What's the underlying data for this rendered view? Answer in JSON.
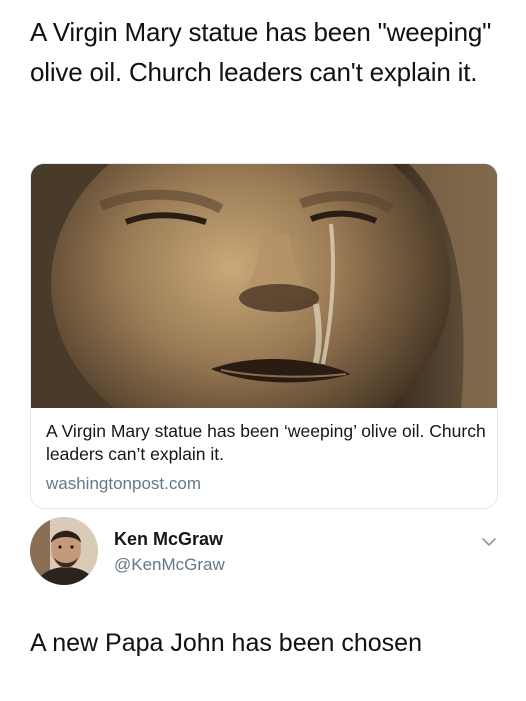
{
  "headline": "A Virgin Mary statue has been \"weeping\" olive oil. Church leaders can't explain it.",
  "card": {
    "title": "A Virgin Mary statue has been ‘weeping’ olive oil. Church leaders can’t explain it.",
    "domain": "washingtonpost.com",
    "image_icon": "statue-face-photo"
  },
  "tweet": {
    "name": "Ken McGraw",
    "handle": "@KenMcGraw",
    "text": "A new Papa John has been chosen",
    "avatar_icon": "avatar-photo",
    "menu_icon": "chevron-down-icon"
  },
  "colors": {
    "text": "#14171a",
    "secondary": "#657786",
    "border": "#e1e8ed"
  }
}
